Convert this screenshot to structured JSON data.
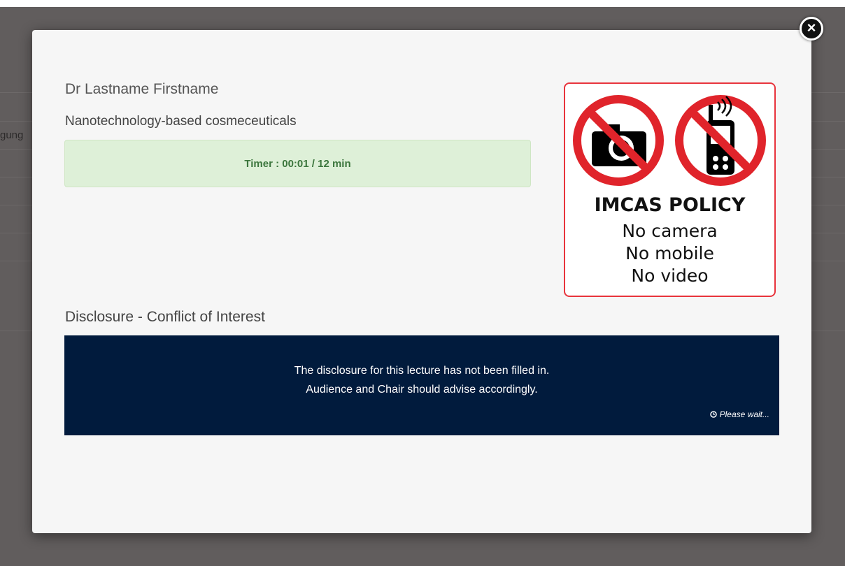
{
  "background": {
    "partial_text": "gung"
  },
  "modal": {
    "close_icon": "×",
    "speaker_name": "Dr Lastname Firstname",
    "lecture_title": "Nanotechnology-based cosmeceuticals",
    "timer": "Timer : 00:01 / 12 min",
    "policy": {
      "icons": [
        "no-camera-icon",
        "no-mobile-icon"
      ],
      "title": "IMCAS POLICY",
      "lines": [
        "No camera",
        "No mobile",
        "No video"
      ],
      "accent_color": "#e8343c"
    },
    "disclosure": {
      "heading": "Disclosure - Conflict of Interest",
      "message_line1": "The disclosure for this lecture has not been filled in.",
      "message_line2": "Audience and Chair should advise accordingly.",
      "wait_text": "Please wait..."
    }
  },
  "colors": {
    "overlay": "#5f5b5b",
    "timer_bg": "#def0d8",
    "timer_text": "#3c763d",
    "disclosure_bg": "#011b3d"
  }
}
